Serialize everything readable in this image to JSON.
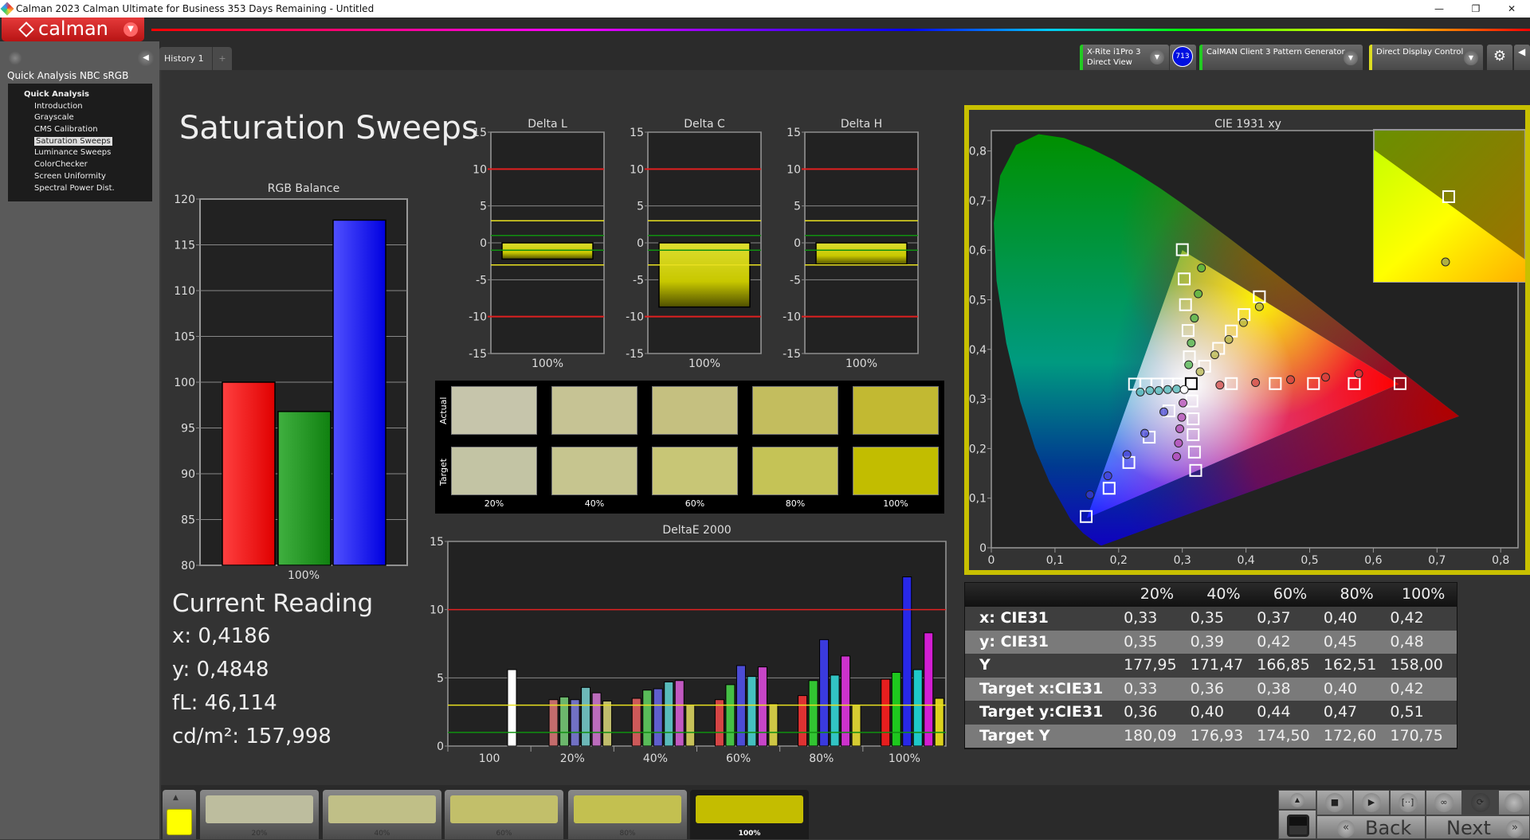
{
  "window": {
    "title": "Calman 2023 Calman Ultimate for Business 353 Days Remaining  - Untitled",
    "min": "—",
    "max": "❐",
    "close": "✕"
  },
  "logo": {
    "text": "calman"
  },
  "sidebar": {
    "workflow": "Quick Analysis NBC sRGB",
    "root": "Quick Analysis",
    "items": [
      "Introduction",
      "Grayscale",
      "CMS Calibration",
      "Saturation Sweeps",
      "Luminance Sweeps",
      "ColorChecker",
      "Screen Uniformity",
      "Spectral Power Dist."
    ],
    "selected": "Saturation Sweeps"
  },
  "tabs": [
    {
      "label": "History 1"
    },
    {
      "label": "+"
    }
  ],
  "devices": {
    "meter_line1": "X-Rite i1Pro 3",
    "meter_line2": "Direct View",
    "meter_badge": "713",
    "generator": "CalMAN Client 3 Pattern Generator",
    "display": "Direct Display Control"
  },
  "page": {
    "title": "Saturation Sweeps"
  },
  "colors": {
    "accent": "#c8c000",
    "red_limit": "#e02020",
    "yellow_limit": "#e8e020",
    "green_limit": "#109010"
  },
  "rgb_balance": {
    "title": "RGB Balance",
    "type": "bar",
    "ylim": [
      80,
      120
    ],
    "yticks": [
      80,
      85,
      90,
      95,
      100,
      105,
      110,
      115,
      120
    ],
    "category": "100%",
    "values": {
      "R": 100,
      "G": 96.8,
      "B": 117.7
    }
  },
  "delta_charts": [
    {
      "title": "Delta L",
      "category": "100%",
      "value": -2.2,
      "ylim": [
        -15,
        15
      ],
      "yticks": [
        15,
        10,
        5,
        0,
        -5,
        -10,
        -15
      ]
    },
    {
      "title": "Delta C",
      "category": "100%",
      "value": -8.7,
      "ylim": [
        -15,
        15
      ],
      "yticks": [
        15,
        10,
        5,
        0,
        -5,
        -10,
        -15
      ]
    },
    {
      "title": "Delta H",
      "category": "100%",
      "value": -2.9,
      "ylim": [
        -15,
        15
      ],
      "yticks": [
        15,
        10,
        5,
        0,
        -5,
        -10,
        -15
      ]
    }
  ],
  "swatches": {
    "actual_label": "Actual",
    "target_label": "Target",
    "labels": [
      "20%",
      "40%",
      "60%",
      "80%",
      "100%"
    ],
    "actual": [
      "#c6c5ab",
      "#c6c394",
      "#c5c080",
      "#c3bd5e",
      "#c2b932"
    ],
    "target": [
      "#c3c4a4",
      "#c6c58f",
      "#c8c676",
      "#c5c356",
      "#c2bd00"
    ]
  },
  "chart_data": {
    "type": "bar",
    "title": "DeltaE 2000",
    "ylim": [
      0,
      15
    ],
    "yticks": [
      0,
      5,
      10,
      15
    ],
    "categories": [
      "100",
      "20%",
      "40%",
      "60%",
      "80%",
      "100%"
    ],
    "series": [
      {
        "name": "White",
        "values": [
          5.6,
          null,
          null,
          null,
          null,
          null
        ]
      },
      {
        "name": "Red",
        "values": [
          null,
          3.4,
          3.5,
          3.4,
          3.7,
          4.9
        ]
      },
      {
        "name": "Green",
        "values": [
          null,
          3.6,
          4.1,
          4.5,
          4.8,
          5.4
        ]
      },
      {
        "name": "Blue",
        "values": [
          null,
          3.4,
          4.2,
          5.9,
          7.8,
          12.4
        ]
      },
      {
        "name": "Cyan",
        "values": [
          null,
          4.3,
          4.7,
          5.1,
          5.2,
          5.6
        ]
      },
      {
        "name": "Magenta",
        "values": [
          null,
          3.9,
          4.8,
          5.8,
          6.6,
          8.3
        ]
      },
      {
        "name": "Yellow",
        "values": [
          null,
          3.3,
          3.0,
          3.1,
          3.0,
          3.5
        ]
      }
    ],
    "thresholds": [
      10,
      3,
      1
    ]
  },
  "current": {
    "title": "Current Reading",
    "x": "x: 0,4186",
    "y": "y: 0,4848",
    "fl": "fL: 46,114",
    "cd": "cd/m²: 157,998"
  },
  "cie": {
    "title": "CIE 1931 xy",
    "xticks": [
      "0",
      "0,1",
      "0,2",
      "0,3",
      "0,4",
      "0,5",
      "0,6",
      "0,7",
      "0,8"
    ],
    "yticks": [
      "0",
      "0,1",
      "0,2",
      "0,3",
      "0,4",
      "0,5",
      "0,6",
      "0,7",
      "0,8"
    ],
    "white_target": [
      0.314,
      0.331
    ],
    "white_measured": [
      0.303,
      0.319
    ],
    "targets": {
      "R": [
        [
          0.377,
          0.331
        ],
        [
          0.446,
          0.331
        ],
        [
          0.506,
          0.331
        ],
        [
          0.57,
          0.331
        ],
        [
          0.642,
          0.331
        ]
      ],
      "G": [
        [
          0.311,
          0.385
        ],
        [
          0.309,
          0.438
        ],
        [
          0.305,
          0.49
        ],
        [
          0.303,
          0.542
        ],
        [
          0.3,
          0.601
        ]
      ],
      "B": [
        [
          0.279,
          0.276
        ],
        [
          0.248,
          0.223
        ],
        [
          0.216,
          0.172
        ],
        [
          0.185,
          0.12
        ],
        [
          0.149,
          0.063
        ]
      ],
      "C": [
        [
          0.294,
          0.33
        ],
        [
          0.277,
          0.33
        ],
        [
          0.26,
          0.33
        ],
        [
          0.243,
          0.33
        ],
        [
          0.225,
          0.33
        ]
      ],
      "M": [
        [
          0.315,
          0.296
        ],
        [
          0.317,
          0.26
        ],
        [
          0.317,
          0.228
        ],
        [
          0.319,
          0.193
        ],
        [
          0.321,
          0.156
        ]
      ],
      "Y": [
        [
          0.335,
          0.366
        ],
        [
          0.357,
          0.402
        ],
        [
          0.377,
          0.437
        ],
        [
          0.397,
          0.47
        ],
        [
          0.421,
          0.506
        ]
      ]
    },
    "measured": {
      "R": [
        [
          0.359,
          0.328
        ],
        [
          0.415,
          0.333
        ],
        [
          0.47,
          0.339
        ],
        [
          0.525,
          0.344
        ],
        [
          0.577,
          0.351
        ]
      ],
      "G": [
        [
          0.31,
          0.369
        ],
        [
          0.314,
          0.413
        ],
        [
          0.319,
          0.463
        ],
        [
          0.325,
          0.512
        ],
        [
          0.33,
          0.564
        ]
      ],
      "B": [
        [
          0.271,
          0.274
        ],
        [
          0.241,
          0.231
        ],
        [
          0.213,
          0.188
        ],
        [
          0.183,
          0.145
        ],
        [
          0.155,
          0.107
        ]
      ],
      "C": [
        [
          0.291,
          0.32
        ],
        [
          0.277,
          0.319
        ],
        [
          0.263,
          0.317
        ],
        [
          0.249,
          0.317
        ],
        [
          0.234,
          0.314
        ]
      ],
      "M": [
        [
          0.301,
          0.292
        ],
        [
          0.299,
          0.263
        ],
        [
          0.296,
          0.24
        ],
        [
          0.294,
          0.211
        ],
        [
          0.291,
          0.184
        ]
      ],
      "Y": [
        [
          0.328,
          0.355
        ],
        [
          0.351,
          0.389
        ],
        [
          0.373,
          0.42
        ],
        [
          0.396,
          0.454
        ],
        [
          0.421,
          0.486
        ]
      ]
    }
  },
  "table": {
    "headers": [
      "",
      "20%",
      "40%",
      "60%",
      "80%",
      "100%"
    ],
    "rows": [
      {
        "label": "x: CIE31",
        "values": [
          "0,33",
          "0,35",
          "0,37",
          "0,40",
          "0,42"
        ]
      },
      {
        "label": "y: CIE31",
        "values": [
          "0,35",
          "0,39",
          "0,42",
          "0,45",
          "0,48"
        ]
      },
      {
        "label": "Y",
        "values": [
          "177,95",
          "171,47",
          "166,85",
          "162,51",
          "158,00"
        ]
      },
      {
        "label": "Target x:CIE31",
        "values": [
          "0,33",
          "0,36",
          "0,38",
          "0,40",
          "0,42"
        ]
      },
      {
        "label": "Target y:CIE31",
        "values": [
          "0,36",
          "0,40",
          "0,44",
          "0,47",
          "0,51"
        ]
      },
      {
        "label": "Target Y",
        "values": [
          "180,09",
          "176,93",
          "174,50",
          "172,60",
          "170,75"
        ]
      }
    ]
  },
  "bottom": {
    "current_color": "#ffff00",
    "steps": [
      {
        "label": "20%",
        "color": "#bdbd9e"
      },
      {
        "label": "40%",
        "color": "#c0bf87"
      },
      {
        "label": "60%",
        "color": "#c2bf6a"
      },
      {
        "label": "80%",
        "color": "#c3c050"
      },
      {
        "label": "100%",
        "color": "#c4bd00"
      }
    ],
    "selected": "100%",
    "back": "Back",
    "next": "Next"
  }
}
